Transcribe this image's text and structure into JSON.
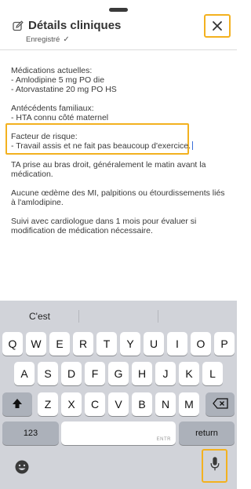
{
  "header": {
    "title": "Détails cliniques",
    "saved_status": "Enregistré",
    "icons": {
      "edit": "pencil-square-icon",
      "saved": "checkmark-icon",
      "close": "close-x-icon"
    }
  },
  "notes": {
    "medications": {
      "heading": "Médications actuelles:",
      "items": [
        "- Amlodipine 5 mg PO die",
        "- Atorvastatine 20 mg PO HS"
      ]
    },
    "family_history": {
      "heading": "Antécédents familiaux:",
      "items": [
        "- HTA connu côté maternel"
      ]
    },
    "risk_factor": {
      "heading": "Facteur de risque:",
      "items": [
        "- Travail assis et ne fait pas beaucoup d'exercice."
      ]
    },
    "paragraphs": [
      "TA prise au bras droit, généralement le matin avant la médication.",
      "Aucune œdème des MI, palpitions ou étourdissements liés à l'amlodipine.",
      "Suivi avec cardiologue dans 1 mois pour évaluer si modification de médication nécessaire."
    ]
  },
  "keyboard": {
    "suggestions": [
      "C'est",
      "",
      ""
    ],
    "row1": [
      "Q",
      "W",
      "E",
      "R",
      "T",
      "Y",
      "U",
      "I",
      "O",
      "P"
    ],
    "row2": [
      "A",
      "S",
      "D",
      "F",
      "G",
      "H",
      "J",
      "K",
      "L"
    ],
    "row3": [
      "Z",
      "X",
      "C",
      "V",
      "B",
      "N",
      "M"
    ],
    "numbers_label": "123",
    "space_hint": "ENTR",
    "return_label": "return",
    "icons": {
      "shift": "shift-arrow-icon",
      "delete": "backspace-icon",
      "emoji": "emoji-face-icon",
      "mic": "microphone-icon"
    }
  },
  "colors": {
    "highlight": "#f3b11f",
    "caret": "#3b6fd8",
    "keyboard_bg": "#d1d3d9",
    "dark_key": "#acb1ba"
  }
}
